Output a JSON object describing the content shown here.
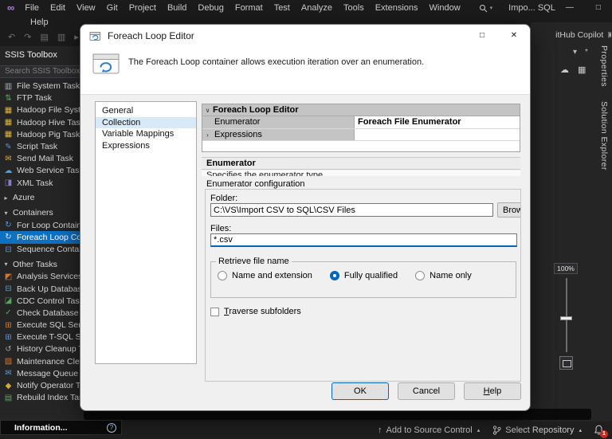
{
  "titlebar": {
    "menus": [
      "File",
      "Edit",
      "View",
      "Git",
      "Project",
      "Build",
      "Debug",
      "Format",
      "Test",
      "Analyze",
      "Tools",
      "Extensions",
      "Window"
    ],
    "help_menu": "Help",
    "doc_title": "Impo... SQL",
    "window_controls": {
      "minimize": "—",
      "maximize": "□",
      "close": "✕"
    }
  },
  "toolbar": {
    "icons": [
      {
        "name": "back-icon",
        "glyph": "↶"
      },
      {
        "name": "forward-icon",
        "glyph": "↷"
      },
      {
        "name": "new-file-icon",
        "glyph": "▤"
      },
      {
        "name": "save-icon",
        "glyph": "▥"
      },
      {
        "name": "start-icon",
        "glyph": "▸"
      }
    ]
  },
  "toolbox": {
    "title": "SSIS Toolbox",
    "search_placeholder": "Search SSIS Toolbox",
    "entries": [
      {
        "type": "item",
        "label": "File System Task",
        "icon": "file-system-task-icon",
        "glyph": "▥",
        "color": "#a9b2ba"
      },
      {
        "type": "item",
        "label": "FTP Task",
        "icon": "ftp-task-icon",
        "glyph": "⇅",
        "color": "#57a65f"
      },
      {
        "type": "item",
        "label": "Hadoop File System Task",
        "icon": "hadoop-file-system-task-icon",
        "glyph": "▦",
        "color": "#e0b43e"
      },
      {
        "type": "item",
        "label": "Hadoop Hive Task",
        "icon": "hadoop-hive-task-icon",
        "glyph": "▦",
        "color": "#e0b43e"
      },
      {
        "type": "item",
        "label": "Hadoop Pig Task",
        "icon": "hadoop-pig-task-icon",
        "glyph": "▦",
        "color": "#e0b43e"
      },
      {
        "type": "item",
        "label": "Script Task",
        "icon": "script-task-icon",
        "glyph": "✎",
        "color": "#5b93d6"
      },
      {
        "type": "item",
        "label": "Send Mail Task",
        "icon": "send-mail-task-icon",
        "glyph": "✉",
        "color": "#d3aa3c"
      },
      {
        "type": "item",
        "label": "Web Service Task",
        "icon": "web-service-task-icon",
        "glyph": "☁",
        "color": "#5b9bd5"
      },
      {
        "type": "item",
        "label": "XML Task",
        "icon": "xml-task-icon",
        "glyph": "◨",
        "color": "#8d7bc9"
      },
      {
        "type": "section",
        "label": "Azure",
        "collapsed": true
      },
      {
        "type": "section",
        "label": "Containers",
        "collapsed": false
      },
      {
        "type": "item",
        "label": "For Loop Container",
        "icon": "for-loop-container-icon",
        "glyph": "↻",
        "color": "#5b93d6"
      },
      {
        "type": "item",
        "label": "Foreach Loop Container",
        "icon": "foreach-loop-container-icon",
        "glyph": "↻",
        "color": "#cfe6ff",
        "selected": true
      },
      {
        "type": "item",
        "label": "Sequence Container",
        "icon": "sequence-container-icon",
        "glyph": "⊟",
        "color": "#5b93d6"
      },
      {
        "type": "section",
        "label": "Other Tasks",
        "collapsed": false
      },
      {
        "type": "item",
        "label": "Analysis Services Processing Task",
        "icon": "analysis-services-processing-task-icon",
        "glyph": "◩",
        "color": "#cf7a33"
      },
      {
        "type": "item",
        "label": "Back Up Database Task",
        "icon": "back-up-database-task-icon",
        "glyph": "⊟",
        "color": "#5b9bd5"
      },
      {
        "type": "item",
        "label": "CDC Control Task",
        "icon": "cdc-control-task-icon",
        "glyph": "◪",
        "color": "#57a65f"
      },
      {
        "type": "item",
        "label": "Check Database Integrity Task",
        "icon": "check-database-integrity-task-icon",
        "glyph": "✓",
        "color": "#57a65f"
      },
      {
        "type": "item",
        "label": "Execute SQL Server Agent Job Task",
        "icon": "execute-sql-server-agent-job-task-icon",
        "glyph": "⊞",
        "color": "#cf7a33"
      },
      {
        "type": "item",
        "label": "Execute T-SQL Statement Task",
        "icon": "execute-t-sql-statement-task-icon",
        "glyph": "⊞",
        "color": "#5b93d6"
      },
      {
        "type": "item",
        "label": "History Cleanup Task",
        "icon": "history-cleanup-task-icon",
        "glyph": "↺",
        "color": "#9aa0a6"
      },
      {
        "type": "item",
        "label": "Maintenance Cleanup Task",
        "icon": "maintenance-cleanup-task-icon",
        "glyph": "▨",
        "color": "#cf7a33"
      },
      {
        "type": "item",
        "label": "Message Queue Task",
        "icon": "message-queue-task-icon",
        "glyph": "✉",
        "color": "#5b9bd5"
      },
      {
        "type": "item",
        "label": "Notify Operator Task",
        "icon": "notify-operator-task-icon",
        "glyph": "◆",
        "color": "#d3aa3c"
      },
      {
        "type": "item",
        "label": "Rebuild Index Task",
        "icon": "rebuild-index-task-icon",
        "glyph": "▤",
        "color": "#57a65f"
      }
    ],
    "footer_label": "Information..."
  },
  "dialog": {
    "title": "Foreach Loop Editor",
    "window_controls": {
      "maximize": "□",
      "close": "✕"
    },
    "description": "The Foreach Loop container allows execution iteration over an enumeration.",
    "nav_items": [
      "General",
      "Collection",
      "Variable Mappings",
      "Expressions"
    ],
    "selected_nav": "Collection",
    "property_grid": {
      "header": "Foreach Loop Editor",
      "rows": [
        {
          "name": "Enumerator",
          "value": "Foreach File Enumerator",
          "expander": ""
        },
        {
          "name": "Expressions",
          "value": "",
          "expander": "›"
        }
      ]
    },
    "section": {
      "title": "Enumerator",
      "subtitle": "Specifies the enumerator type"
    },
    "config": {
      "group_label": "Enumerator configuration",
      "folder_label": "Folder:",
      "folder_value": "C:\\VS\\Import CSV to SQL\\CSV Files",
      "browse_label": "Browse...",
      "files_label": "Files:",
      "files_value": "*.csv",
      "retrieve_label": "Retrieve file name",
      "radio_options": [
        {
          "label": "Name and extension",
          "selected": false
        },
        {
          "label": "Fully qualified",
          "selected": true
        },
        {
          "label": "Name only",
          "selected": false
        }
      ],
      "traverse_label": "Traverse subfolders",
      "traverse_checked": false
    },
    "buttons": {
      "ok": "OK",
      "cancel": "Cancel",
      "help": "Help"
    }
  },
  "right_panel": {
    "copilot_tab": "GitHub Copilot",
    "tabs": [
      "Properties",
      "Solution Explorer"
    ],
    "zoom_level": "100%"
  },
  "statusbar": {
    "add_to_source_control": "Add to Source Control",
    "select_repository": "Select Repository",
    "notification_count": "1"
  }
}
